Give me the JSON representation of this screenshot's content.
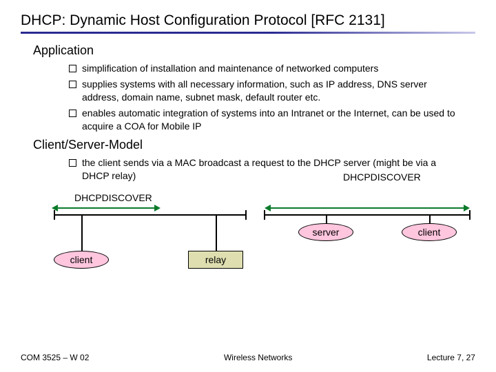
{
  "title": "DHCP: Dynamic Host Configuration Protocol [RFC 2131]",
  "sections": {
    "application": {
      "heading": "Application",
      "bullets": [
        "simplification of installation and maintenance of networked computers",
        "supplies systems with all necessary information, such as IP address, DNS server address, domain name, subnet mask, default router etc.",
        "enables automatic integration of systems into an Intranet or the Internet, can be used to acquire a COA for Mobile IP"
      ]
    },
    "clientserver": {
      "heading": "Client/Server-Model",
      "bullets": [
        "the client sends via a MAC broadcast a request to the DHCP server (might be via a DHCP relay)"
      ]
    }
  },
  "diagram": {
    "discover_left": "DHCPDISCOVER",
    "discover_right": "DHCPDISCOVER",
    "server": "server",
    "client_left": "client",
    "client_right": "client",
    "relay": "relay"
  },
  "footer": {
    "left": "COM 3525 – W 02",
    "center": "Wireless Networks",
    "right": "Lecture 7, 27"
  }
}
